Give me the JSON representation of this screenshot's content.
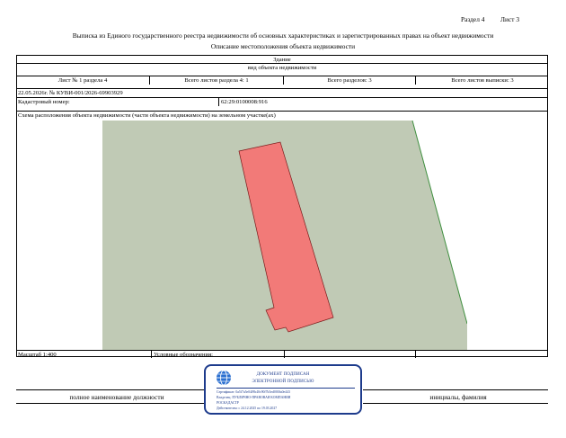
{
  "header": {
    "section": "Раздел 4",
    "sheet": "Лист 3",
    "title": "Выписка из Единого государственного реестра недвижимости об основных характеристиках и зарегистрированных правах на объект недвижимости",
    "subtitle": "Описание местоположения объекта недвижимости"
  },
  "object": {
    "type": "Здание",
    "type_caption": "вид объекта недвижимости"
  },
  "sheet_info": {
    "sheet_in_section": "Лист № 1 раздела 4",
    "total_sheets_section": "Всего листов раздела 4: 1",
    "total_sections": "Всего разделов: 3",
    "total_sheets": "Всего листов выписки: 3"
  },
  "doc": {
    "date_number": "22.05.2026г. № КУВИ-001/2026-69903929",
    "cadastral_label": "Кадастровый номер:",
    "cadastral_number": "62:29:0100008:916"
  },
  "scheme": {
    "caption": "Схема расположения объекта недвижимости (части объекта недвижимости) на земельном участке(ах)",
    "scale": "Масштаб 1:400",
    "legend_label": "Условные обозначения:",
    "colors": {
      "land": "#c0cab5",
      "building": "#f27a78",
      "boundary": "#3f8f3f",
      "building_outline": "#7a1a1a"
    }
  },
  "signature": {
    "position_label": "полное наименование должности",
    "name_label": "инициалы, фамилия"
  },
  "stamp": {
    "line1": "ДОКУМЕНТ ПОДПИСАН",
    "line2": "ЭЛЕКТРОННОЙ ПОДПИСЬЮ",
    "cert": "Сертификат: 0a5f7a5e04f9b40c90f7b5ed000fa0e443",
    "owner": "Владелец: ПУБЛИЧНО-ПРАВОВАЯ КОМПАНИЯ",
    "org": "РОСКАДАСТР",
    "valid": "Действителен: с 24.12.2025 по 19.03.2027",
    "icon": "globe-icon"
  }
}
